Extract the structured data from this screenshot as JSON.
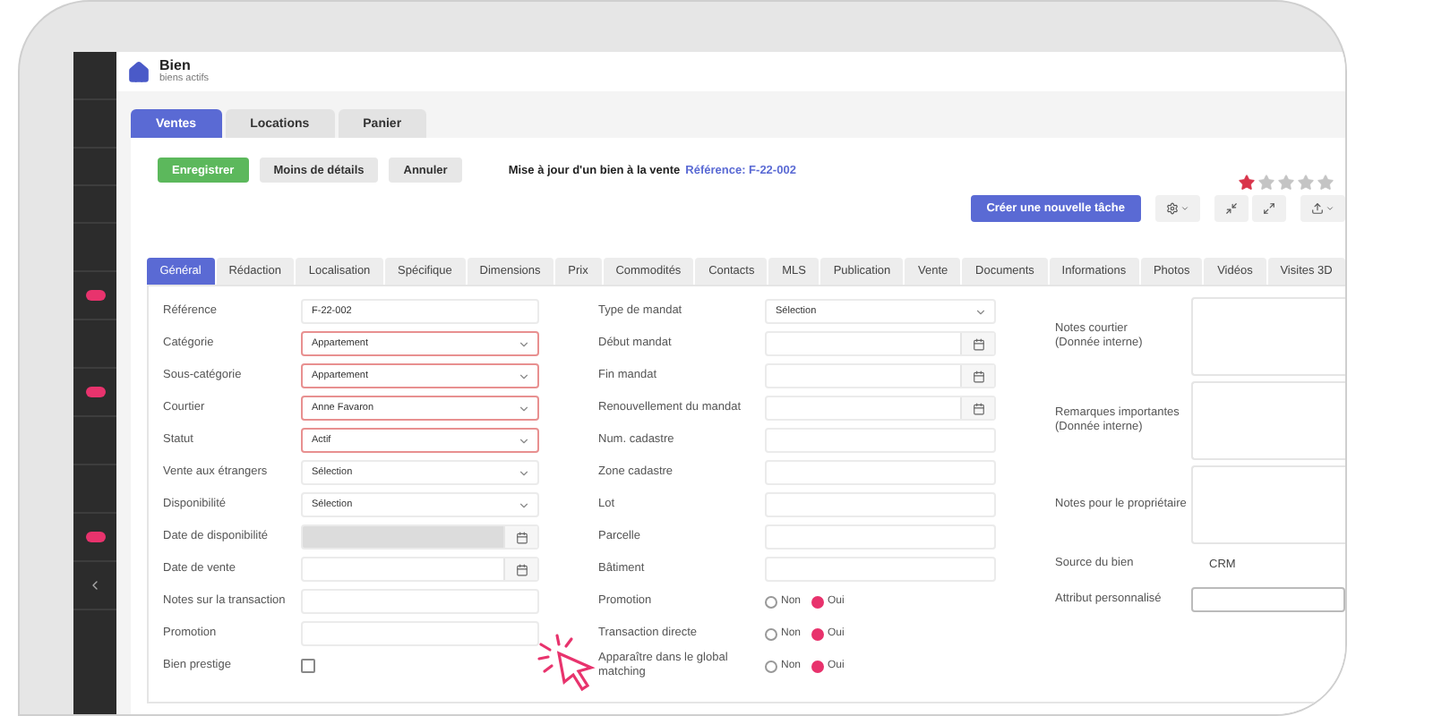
{
  "app_header": {
    "title": "Bien",
    "subtitle": "biens actifs"
  },
  "main_tabs": [
    {
      "label": "Ventes",
      "selected": true
    },
    {
      "label": "Locations",
      "selected": false
    },
    {
      "label": "Panier",
      "selected": false
    }
  ],
  "actions": [
    {
      "label": "Enregistrer",
      "kind": "primary"
    },
    {
      "label": "Moins de détails",
      "kind": "default"
    },
    {
      "label": "Annuler",
      "kind": "default"
    }
  ],
  "form_title": "Mise à jour d'un bien à la vente",
  "reference": "Référence: F-22-002",
  "rating": {
    "stars": 1
  },
  "task_button": "Créer une nouvelle tâche",
  "section_tabs": [
    {
      "label": "Général",
      "selected": true
    },
    {
      "label": "Rédaction",
      "selected": false
    },
    {
      "label": "Localisation",
      "selected": false
    },
    {
      "label": "Spécifique",
      "selected": false
    },
    {
      "label": "Dimensions",
      "selected": false
    },
    {
      "label": "Prix",
      "selected": false
    },
    {
      "label": "Commodités",
      "selected": false
    },
    {
      "label": "Contacts",
      "selected": false
    },
    {
      "label": "MLS",
      "selected": false
    },
    {
      "label": "Publication",
      "selected": false
    },
    {
      "label": "Vente",
      "selected": false
    },
    {
      "label": "Documents",
      "selected": false
    },
    {
      "label": "Informations",
      "selected": false
    },
    {
      "label": "Photos",
      "selected": false
    },
    {
      "label": "Vidéos",
      "selected": false
    },
    {
      "label": "Visites 3D",
      "selected": false
    }
  ],
  "form": {
    "left": [
      {
        "kind": "text",
        "label": "Référence",
        "value": "F-22-002"
      },
      {
        "kind": "select",
        "label": "Catégorie",
        "value": "Appartement",
        "error": true
      },
      {
        "kind": "select",
        "label": "Sous-catégorie",
        "value": "Appartement",
        "error": true
      },
      {
        "kind": "select",
        "label": "Courtier",
        "value": "Anne Favaron",
        "error": true
      },
      {
        "kind": "select",
        "label": "Statut",
        "value": "Actif",
        "error": true
      },
      {
        "kind": "select",
        "label": "Vente aux étrangers",
        "value": "Sélection",
        "error": false
      },
      {
        "kind": "select",
        "label": "Disponibilité",
        "value": "Sélection",
        "error": false
      },
      {
        "kind": "date",
        "label": "Date de disponibilité",
        "disabled": true
      },
      {
        "kind": "date",
        "label": "Date de vente",
        "disabled": false
      },
      {
        "kind": "text",
        "label": "Notes sur la transaction"
      },
      {
        "kind": "text",
        "label": "Promotion"
      },
      {
        "kind": "checkbox",
        "label": "Bien prestige",
        "checked": false
      }
    ],
    "middle": [
      {
        "kind": "select",
        "label": "Type de mandat",
        "value": "Sélection",
        "error": false
      },
      {
        "kind": "date",
        "label": "Début mandat",
        "disabled": false
      },
      {
        "kind": "date",
        "label": "Fin mandat",
        "disabled": false
      },
      {
        "kind": "date",
        "label": "Renouvellement du mandat",
        "disabled": false
      },
      {
        "kind": "text",
        "label": "Num. cadastre"
      },
      {
        "kind": "text",
        "label": "Zone cadastre"
      },
      {
        "kind": "text",
        "label": "Lot"
      },
      {
        "kind": "text",
        "label": "Parcelle"
      },
      {
        "kind": "text",
        "label": "Bâtiment"
      },
      {
        "kind": "radio",
        "label": "Promotion",
        "options": [
          {
            "label": "Non",
            "selected": false
          },
          {
            "label": "Oui",
            "selected": true
          }
        ]
      },
      {
        "kind": "radio",
        "label": "Transaction directe",
        "options": [
          {
            "label": "Non",
            "selected": false
          },
          {
            "label": "Oui",
            "selected": true
          }
        ]
      },
      {
        "kind": "radio",
        "label": "Apparaître dans le global matching",
        "options": [
          {
            "label": "Non",
            "selected": false
          },
          {
            "label": "Oui",
            "selected": true
          }
        ]
      }
    ],
    "right": [
      {
        "kind": "textarea",
        "label": "Notes courtier\n(Donnée interne)"
      },
      {
        "kind": "textarea",
        "label": "Remarques importantes\n(Donnée interne)"
      },
      {
        "kind": "textarea",
        "label": "Notes pour le propriétaire"
      },
      {
        "kind": "static",
        "label": "Source du bien",
        "value": "CRM"
      },
      {
        "kind": "text",
        "label": "Attribut personnalisé"
      }
    ]
  }
}
